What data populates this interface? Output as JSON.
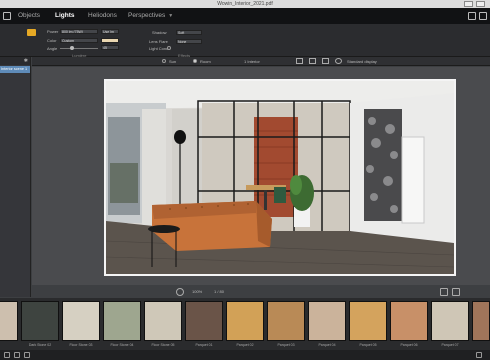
{
  "window": {
    "document_title": "Wowin_Interior_2021.pdf"
  },
  "menubar": {
    "tabs": [
      {
        "label": "Objects"
      },
      {
        "label": "Lights"
      },
      {
        "label": "Heliodons"
      },
      {
        "label": "Perspectives"
      }
    ],
    "active_tab": "Lights"
  },
  "ribbon": {
    "power_label": "Power",
    "power_value": "800 lm (75W)",
    "power_unit": "Use lm",
    "color_label": "Color",
    "color_value": "Custom",
    "angle_label": "Angle",
    "angle_value": "45",
    "group_lumiere": "Lumière",
    "shadow_label": "Shadow",
    "shadow_value": "Soft",
    "lensflare_label": "Lens Flare",
    "lensflare_value": "None",
    "lightcone_label": "Light Cone",
    "group_effects": "Effects"
  },
  "viewbar": {
    "sun_label": "Sun",
    "room_label": "Room",
    "interior_label": "1 Interior",
    "standard_label": "Standard display"
  },
  "leftpanel": {
    "item_label": "Interior scene 1"
  },
  "bottombar": {
    "zoom": "100%",
    "info": "1 / 80"
  },
  "materials": [
    {
      "label": "Floor Stone 01"
    },
    {
      "label": "Dark Stone 02"
    },
    {
      "label": "Floor Stone 03"
    },
    {
      "label": "Floor Stone 04"
    },
    {
      "label": "Floor Stone 05"
    },
    {
      "label": "Parquet 01"
    },
    {
      "label": "Parquet 02"
    },
    {
      "label": "Parquet 03"
    },
    {
      "label": "Parquet 04"
    },
    {
      "label": "Parquet 05"
    },
    {
      "label": "Parquet 06"
    },
    {
      "label": "Parquet 07"
    }
  ],
  "colors": {
    "accent": "#e6a925",
    "selection": "#5e8bb8"
  }
}
